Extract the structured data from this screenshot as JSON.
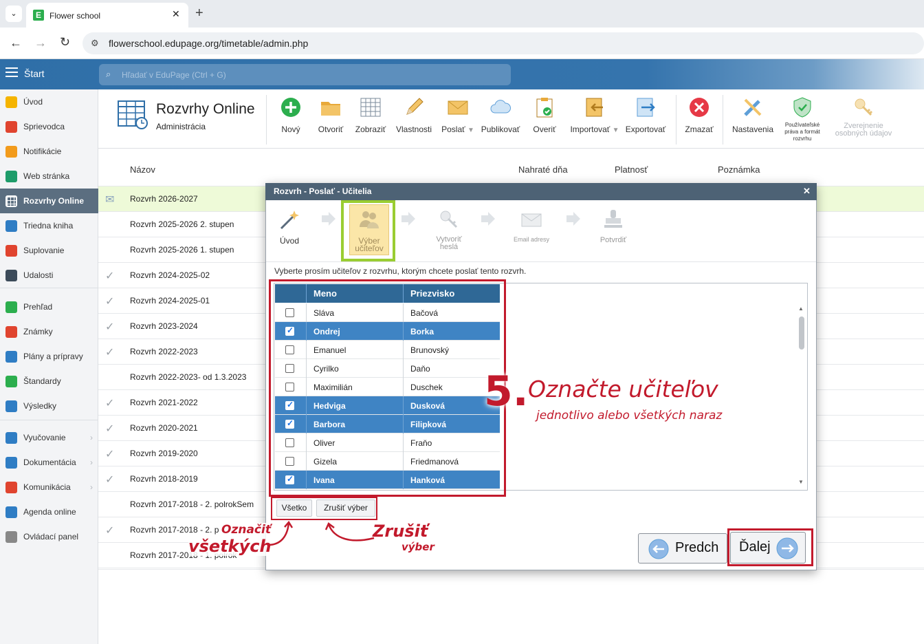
{
  "browser": {
    "tab_title": "Flower school",
    "url": "flowerschool.edupage.org/timetable/admin.php"
  },
  "header": {
    "menu_label": "Štart",
    "search_placeholder": "Hľadať v EduPage (Ctrl + G)"
  },
  "sidebar": {
    "items": [
      {
        "label": "Úvod",
        "icon": "star-icon",
        "color": "#f5b400"
      },
      {
        "label": "Sprievodca",
        "icon": "magic-icon",
        "color": "#e0442f"
      },
      {
        "label": "Notifikácie",
        "icon": "envelope-icon",
        "color": "#f29b1c"
      },
      {
        "label": "Web stránka",
        "icon": "house-icon",
        "color": "#1e9c6a"
      },
      {
        "label": "Rozvrhy Online",
        "icon": "grid-icon",
        "color": "#ffffff"
      },
      {
        "label": "Triedna kniha",
        "icon": "book-icon",
        "color": "#2f7dc4"
      },
      {
        "label": "Suplovanie",
        "icon": "person-icon",
        "color": "#e0442f"
      },
      {
        "label": "Udalosti",
        "icon": "calendar-icon",
        "color": "#3c4b5a"
      },
      {
        "label": "Prehľad",
        "icon": "check-circle-icon",
        "color": "#2cae4e"
      },
      {
        "label": "Známky",
        "icon": "grades-icon",
        "color": "#e0442f"
      },
      {
        "label": "Plány a prípravy",
        "icon": "briefcase-icon",
        "color": "#2f7dc4"
      },
      {
        "label": "Štandardy",
        "icon": "shield-icon",
        "color": "#2cae4e"
      },
      {
        "label": "Výsledky",
        "icon": "chart-icon",
        "color": "#2f7dc4"
      },
      {
        "label": "Vyučovanie",
        "icon": "open-book-icon",
        "color": "#2f7dc4"
      },
      {
        "label": "Dokumentácia",
        "icon": "document-icon",
        "color": "#2f7dc4"
      },
      {
        "label": "Komunikácia",
        "icon": "chat-icon",
        "color": "#e0442f"
      },
      {
        "label": "Agenda online",
        "icon": "pen-icon",
        "color": "#2f7dc4"
      },
      {
        "label": "Ovládací panel",
        "icon": "gear-icon",
        "color": "#888888"
      }
    ]
  },
  "module": {
    "title": "Rozvrhy Online",
    "subtitle": "Administrácia"
  },
  "toolbar": {
    "novy": "Nový",
    "otvorit": "Otvoriť",
    "zobrazit": "Zobraziť",
    "vlastnosti": "Vlastnosti",
    "poslat": "Poslať",
    "publikovat": "Publikovať",
    "overit": "Overiť",
    "importovat": "Importovať",
    "exportovat": "Exportovať",
    "zmazat": "Zmazať",
    "nastavenia": "Nastavenia",
    "prava": "Používateľské práva a formát rozvrhu",
    "zverejnenie": "Zverejnenie osobných údajov"
  },
  "list": {
    "headers": {
      "name": "Názov",
      "uploaded": "Nahraté dňa",
      "validity": "Platnosť",
      "note": "Poznámka"
    },
    "rows": [
      {
        "name": "Rozvrh 2026-2027",
        "mark": "mail"
      },
      {
        "name": "Rozvrh 2025-2026 2. stupen",
        "mark": ""
      },
      {
        "name": "Rozvrh 2025-2026 1. stupen",
        "mark": ""
      },
      {
        "name": "Rozvrh 2024-2025-02",
        "mark": "check"
      },
      {
        "name": "Rozvrh 2024-2025-01",
        "mark": "check"
      },
      {
        "name": "Rozvrh 2023-2024",
        "mark": "check"
      },
      {
        "name": "Rozvrh 2022-2023",
        "mark": "check"
      },
      {
        "name": "Rozvrh 2022-2023- od 1.3.2023",
        "mark": ""
      },
      {
        "name": "Rozvrh 2021-2022",
        "mark": "check"
      },
      {
        "name": "Rozvrh 2020-2021",
        "mark": "check"
      },
      {
        "name": "Rozvrh 2019-2020",
        "mark": "check"
      },
      {
        "name": "Rozvrh 2018-2019",
        "mark": "check"
      },
      {
        "name": "Rozvrh 2017-2018 - 2. polrokSem",
        "mark": ""
      },
      {
        "name": "Rozvrh 2017-2018 - 2. p",
        "mark": "check"
      },
      {
        "name": "Rozvrh 2017-2018 - 1. polrok",
        "mark": ""
      }
    ]
  },
  "dialog": {
    "title": "Rozvrh - Poslať - Učitelia",
    "steps": [
      "Úvod",
      "Výber učiteľov",
      "Vytvoriť heslá",
      "Email adresy",
      "Potvrdiť"
    ],
    "instruction": "Vyberte prosím učiteľov z rozvrhu, ktorým chcete poslať tento rozvrh.",
    "table": {
      "headers": [
        "Meno",
        "Priezvisko"
      ],
      "rows": [
        {
          "first": "Sláva",
          "last": "Bačová",
          "checked": false
        },
        {
          "first": "Ondrej",
          "last": "Borka",
          "checked": true
        },
        {
          "first": "Emanuel",
          "last": "Brunovský",
          "checked": false
        },
        {
          "first": "Cyrilko",
          "last": "Daňo",
          "checked": false
        },
        {
          "first": "Maximilián",
          "last": "Duschek",
          "checked": false
        },
        {
          "first": "Hedviga",
          "last": "Dusková",
          "checked": true
        },
        {
          "first": "Barbora",
          "last": "Filipková",
          "checked": true
        },
        {
          "first": "Oliver",
          "last": "Fraňo",
          "checked": false
        },
        {
          "first": "Gizela",
          "last": "Friedmanová",
          "checked": false
        },
        {
          "first": "Ivana",
          "last": "Hanková",
          "checked": true
        }
      ]
    },
    "btn_all": "Všetko",
    "btn_clear": "Zrušiť výber",
    "btn_prev": "Predch",
    "btn_next": "Ďalej"
  },
  "annotations": {
    "step_number": "5.",
    "step_title": "Označte učiteľov",
    "step_sub": "jednotlivo alebo všetkých naraz",
    "all_line1": "Označiť",
    "all_line2": "všetkých",
    "clear_line1": "Zrušiť",
    "clear_line2": "výber"
  }
}
